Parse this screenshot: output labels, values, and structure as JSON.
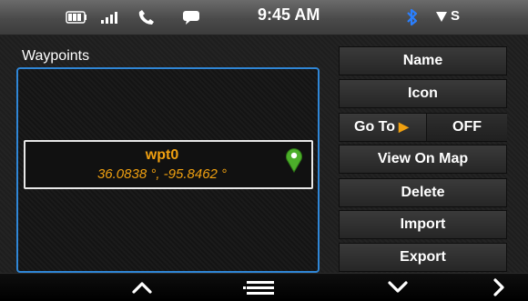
{
  "status_bar": {
    "time": "9:45 AM",
    "network": "S",
    "icons": [
      "battery-icon",
      "signal-icon",
      "phone-icon",
      "message-icon",
      "bluetooth-icon",
      "network-signal-icon"
    ]
  },
  "waypoints": {
    "title": "Waypoints",
    "items": [
      {
        "name": "wpt0",
        "coords": "36.0838 °, -95.8462 °",
        "icon": "map-pin-icon"
      }
    ]
  },
  "actions": {
    "name": "Name",
    "icon": "Icon",
    "go_to": {
      "label": "Go To",
      "value": "OFF"
    },
    "view_on_map": "View On Map",
    "delete": "Delete",
    "import": "Import",
    "export": "Export"
  },
  "nav_bar": {
    "icons": [
      "chevron-up-icon",
      "menu-icon",
      "chevron-down-icon",
      "chevron-right-icon"
    ]
  },
  "colors": {
    "accent_orange": "#f0a010",
    "selection_blue": "#2f86d6",
    "bluetooth_blue": "#2a7fff",
    "pin_green": "#4caf2a"
  }
}
